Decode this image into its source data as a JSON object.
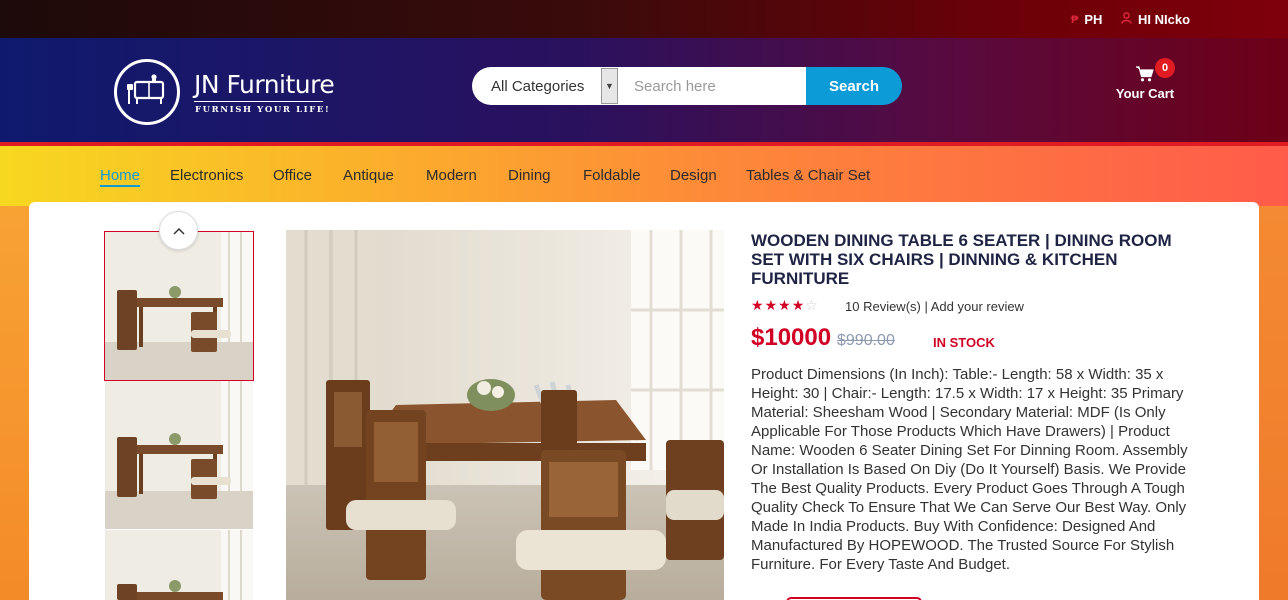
{
  "topbar": {
    "currency": "PH",
    "user_greeting": "HI NIcko",
    "currency_icon": "peso-icon",
    "user_icon": "user-icon"
  },
  "header": {
    "logo_title": "JN Furniture",
    "logo_subtitle": "FURNISH YOUR LIFE!",
    "search": {
      "category_selected": "All Categories",
      "placeholder": "Search here",
      "button_label": "Search"
    },
    "cart": {
      "label": "Your Cart",
      "count": "0",
      "icon": "cart-icon"
    }
  },
  "nav": {
    "items": [
      {
        "label": "Home",
        "active": true
      },
      {
        "label": "Electronics"
      },
      {
        "label": "Office"
      },
      {
        "label": "Antique"
      },
      {
        "label": "Modern"
      },
      {
        "label": "Dining"
      },
      {
        "label": "Foldable"
      },
      {
        "label": "Design"
      },
      {
        "label": "Tables & Chair Set"
      }
    ]
  },
  "product": {
    "title": "Wooden Dining Table 6 Seater | Dining Room Set with Six Chairs | Dinning & Kitchen Furniture",
    "rating": 4,
    "rating_max": 5,
    "reviews_text": "10 Review(s) | Add your review",
    "price": "$10000",
    "old_price": "$990.00",
    "stock": "IN STOCK",
    "description": "Product Dimensions (In Inch): Table:- Length: 58 x Width: 35 x Height: 30 | Chair:- Length: 17.5 x Width: 17 x Height: 35 Primary Material: Sheesham Wood | Secondary Material: MDF (Is Only Applicable For Those Products Which Have Drawers) | Product Name: Wooden 6 Seater Dining Set For Dinning Room. Assembly Or Installation Is Based On Diy (Do It Yourself) Basis. We Provide The Best Quality Products. Every Product Goes Through A Tough Quality Check To Ensure That We Can Serve Our Best Way. Only Made In India Products. Buy With Confidence: Designed And Manufactured By HOPEWOOD. The Trusted Source For Stylish Furniture. For Every Taste And Budget."
  },
  "colors": {
    "accent_red": "#d10024",
    "accent_blue": "#0d9bd8",
    "title_navy": "#1f2344"
  }
}
